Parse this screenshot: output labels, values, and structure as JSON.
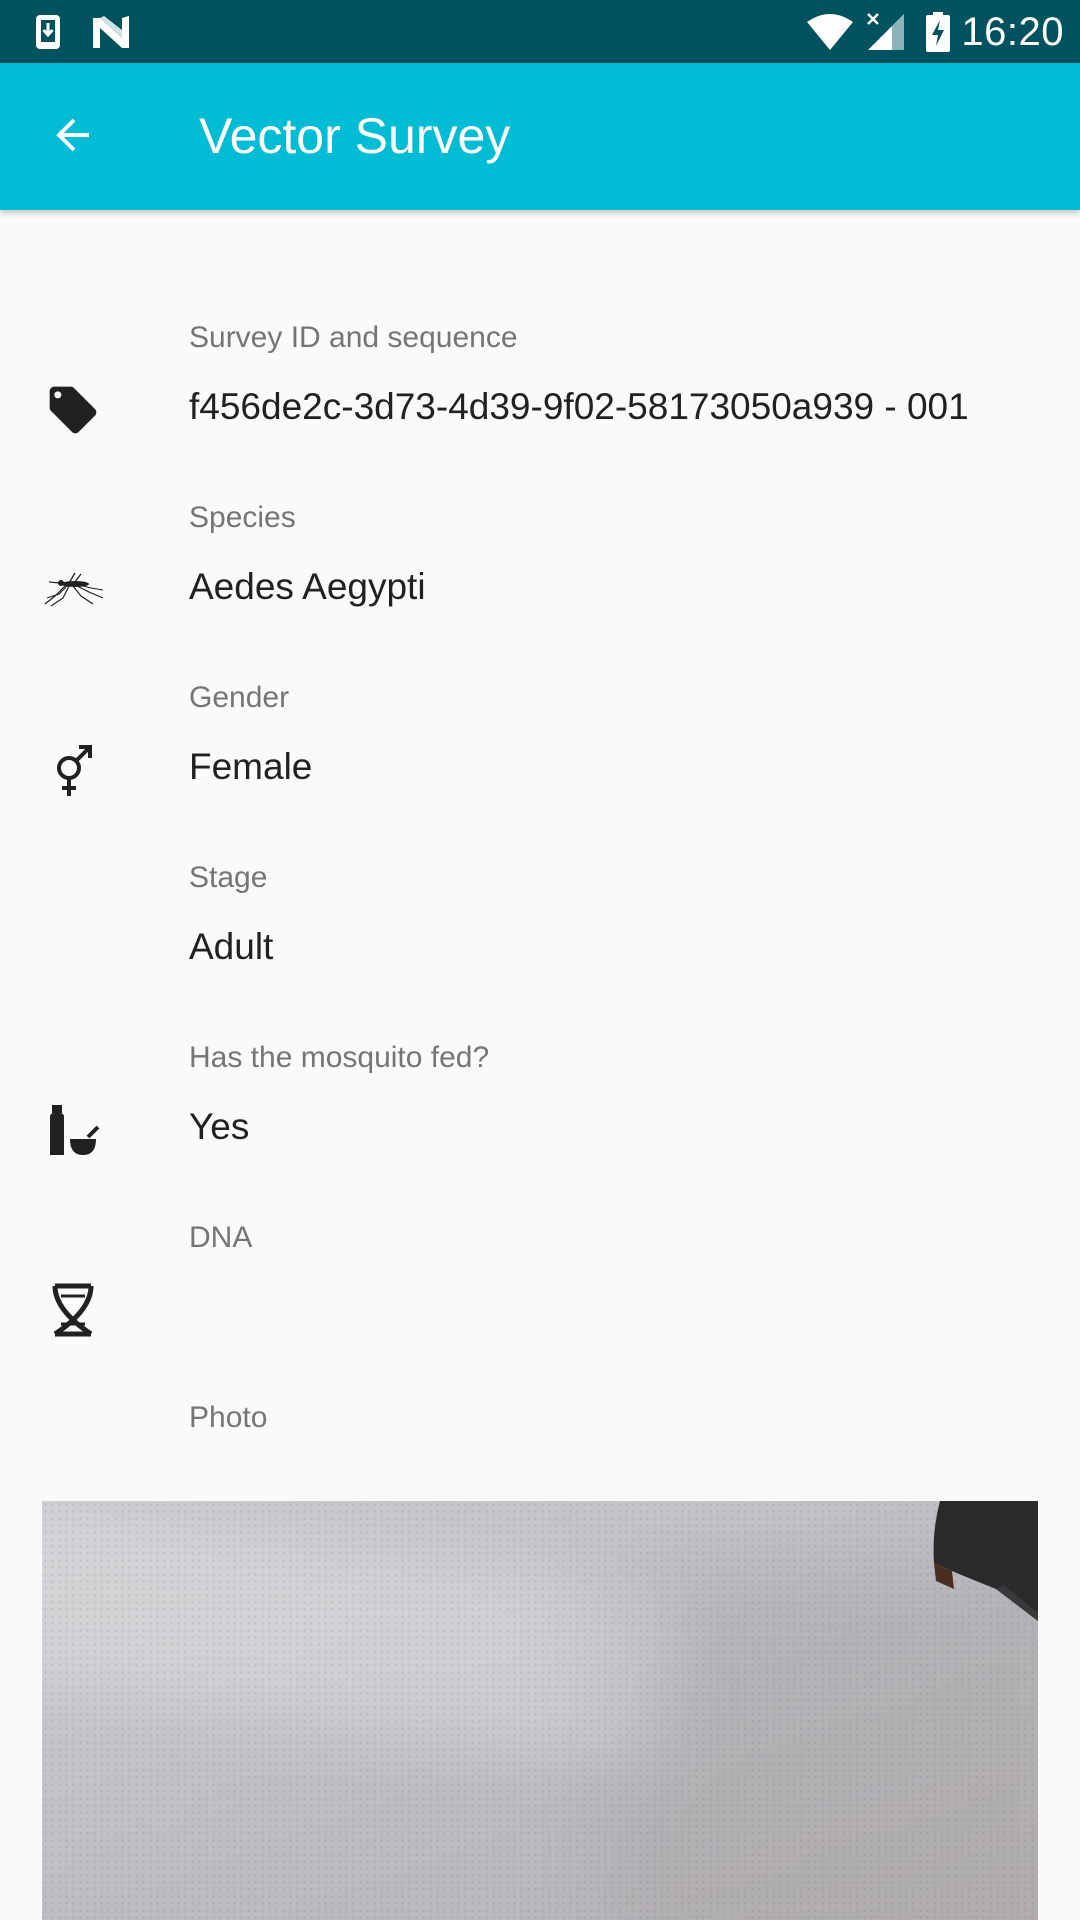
{
  "status_bar": {
    "time": "16:20",
    "left_icons": [
      "download-notification-icon",
      "n-logo-icon"
    ],
    "right_icons": [
      "wifi-icon",
      "cell-signal-no-data-icon",
      "battery-charging-icon"
    ]
  },
  "app_bar": {
    "title": "Vector Survey",
    "back_icon": "arrow-back-icon",
    "background_color": "#00bcd4"
  },
  "fields": {
    "survey_id": {
      "label": "Survey ID and sequence",
      "value": "f456de2c-3d73-4d39-9f02-58173050a939 - 001",
      "icon": "tag-icon"
    },
    "species": {
      "label": "Species",
      "value": "Aedes Aegypti",
      "icon": "mosquito-icon"
    },
    "gender": {
      "label": "Gender",
      "value": "Female",
      "icon": "gender-icon"
    },
    "stage": {
      "label": "Stage",
      "value": "Adult"
    },
    "fed": {
      "label": "Has the mosquito fed?",
      "value": "Yes",
      "icon": "bottle-and-bowl-icon"
    },
    "dna": {
      "label": "DNA",
      "value": "",
      "icon": "dna-icon"
    },
    "photo": {
      "label": "Photo"
    }
  },
  "colors": {
    "status_bar": "#00525e",
    "accent": "#00bcd4",
    "label_text": "#757575",
    "value_text": "#212121"
  }
}
